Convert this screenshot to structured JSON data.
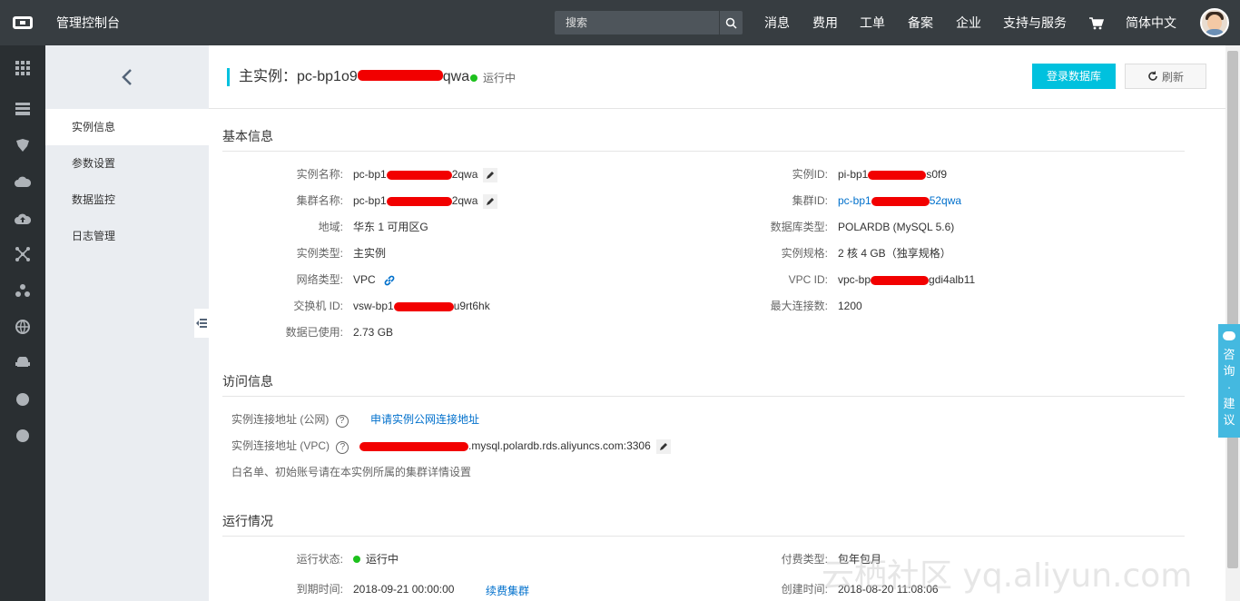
{
  "topbar": {
    "title": "管理控制台",
    "search_placeholder": "搜索",
    "nav": [
      "消息",
      "费用",
      "工单",
      "备案",
      "企业",
      "支持与服务",
      "简体中文"
    ]
  },
  "submenu": {
    "items": [
      "实例信息",
      "参数设置",
      "数据监控",
      "日志管理"
    ]
  },
  "header": {
    "title_prefix": "主实例：",
    "title_id_start": "pc-bp1o9",
    "title_id_end": "qwa",
    "status": "运行中",
    "login_button": "登录数据库",
    "refresh_button": "刷新"
  },
  "basic": {
    "title": "基本信息",
    "instance_name": {
      "label": "实例名称:",
      "start": "pc-bp1",
      "end": "2qwa"
    },
    "cluster_name": {
      "label": "集群名称:",
      "start": "pc-bp1",
      "end": "2qwa"
    },
    "region": {
      "label": "地域:",
      "value": "华东 1 可用区G"
    },
    "instance_type": {
      "label": "实例类型:",
      "value": "主实例"
    },
    "network_type": {
      "label": "网络类型:",
      "value": "VPC"
    },
    "vswitch_id": {
      "label": "交换机 ID:",
      "start": "vsw-bp1",
      "end": "u9rt6hk"
    },
    "data_used": {
      "label": "数据已使用:",
      "value": "2.73 GB"
    },
    "instance_id": {
      "label": "实例ID:",
      "start": "pi-bp1",
      "end": "s0f9"
    },
    "cluster_id": {
      "label": "集群ID:",
      "start": "pc-bp1",
      "end": "52qwa"
    },
    "db_type": {
      "label": "数据库类型:",
      "value": "POLARDB (MySQL 5.6)"
    },
    "spec": {
      "label": "实例规格:",
      "value": "2 核 4 GB（独享规格）"
    },
    "vpc_id": {
      "label": "VPC ID:",
      "start": "vpc-bp",
      "end": "gdi4alb11"
    },
    "max_conn": {
      "label": "最大连接数:",
      "value": "1200"
    }
  },
  "access": {
    "title": "访问信息",
    "public_label": "实例连接地址 (公网)",
    "public_link": "申请实例公网连接地址",
    "vpc_label": "实例连接地址 (VPC)",
    "vpc_value": ".mysql.polardb.rds.aliyuncs.com:3306",
    "note": "白名单、初始账号请在本实例所属的集群详情设置",
    "help_glyph": "?"
  },
  "running": {
    "title": "运行情况",
    "status_label": "运行状态:",
    "status_value": "运行中",
    "expire_label": "到期时间:",
    "expire_value": "2018-09-21 00:00:00",
    "renew_link": "续费集群",
    "pay_label": "付费类型:",
    "pay_value": "包年包月",
    "created_label": "创建时间:",
    "created_value": "2018-08-20 11:08:06"
  },
  "feedback": {
    "chars": [
      "咨",
      "询",
      "·",
      "建",
      "议"
    ]
  },
  "watermark": "云栖社区 yq.aliyun.com",
  "colors": {
    "topbar": "#373d41",
    "accent": "#00c1de",
    "link": "#0070cc",
    "status_green": "#1dc11d"
  }
}
